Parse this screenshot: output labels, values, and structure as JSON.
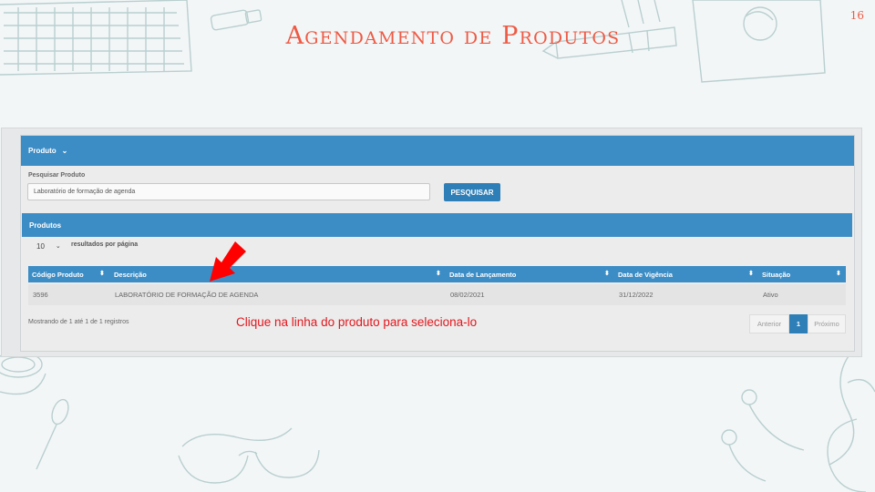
{
  "slide": {
    "title": "Agendamento de Produtos",
    "page_number": "16"
  },
  "app": {
    "section_header": "Produto",
    "search": {
      "label": "Pesquisar Produto",
      "value": "Laboratório de formação de agenda",
      "button": "PESQUISAR"
    },
    "results_header": "Produtos",
    "page_size": {
      "value": "10",
      "label": "resultados por página"
    },
    "table": {
      "columns": [
        "Código Produto",
        "Descrição",
        "Data de Lançamento",
        "Data de Vigência",
        "Situação"
      ],
      "rows": [
        [
          "3596",
          "LABORATÓRIO DE FORMAÇÃO DE AGENDA",
          "08/02/2021",
          "31/12/2022",
          "Ativo"
        ]
      ]
    },
    "info": "Mostrando de 1 até 1 de 1 registros",
    "pagination": {
      "prev": "Anterior",
      "current": "1",
      "next": "Próximo"
    }
  },
  "annotation": {
    "hint": "Clique na linha do produto para seleciona-lo"
  },
  "colors": {
    "title": "#ee5a44",
    "header_blue": "#3c8dc5",
    "button_blue": "#2e7fb8",
    "hint_red": "#e3161c"
  }
}
